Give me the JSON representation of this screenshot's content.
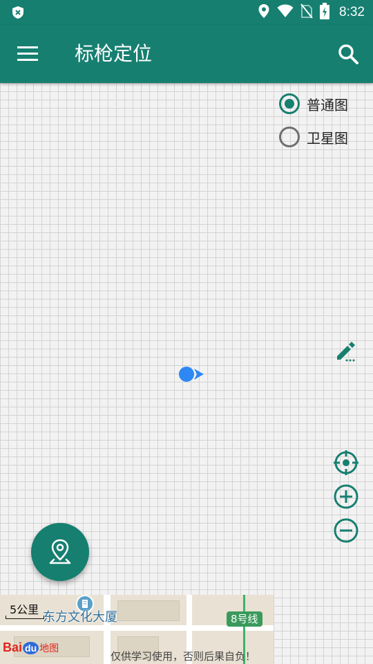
{
  "status_bar": {
    "time": "8:32",
    "icons": [
      "shield-x-icon",
      "location-icon",
      "wifi-icon",
      "no-sim-icon",
      "battery-icon"
    ]
  },
  "app_bar": {
    "title": "标枪定位",
    "menu_icon": "menu-icon",
    "search_icon": "search-icon"
  },
  "map": {
    "map_types": [
      {
        "label": "普通图",
        "selected": true
      },
      {
        "label": "卫星图",
        "selected": false
      }
    ],
    "controls": [
      "edit-icon",
      "my-location-icon",
      "zoom-in-icon",
      "zoom-out-icon"
    ],
    "scale_label": "5公里",
    "poi_name": "东方文化大厦",
    "metro_label": "8号线",
    "logo": {
      "bai": "Bai",
      "du": "du",
      "ditu": "地图"
    },
    "disclaimer": "仅供学习使用，否则后果自负！"
  },
  "fab_icon": "location-pin-icon",
  "colors": {
    "primary": "#167f70",
    "location_dot": "#2d88f3",
    "grid_line": "#d3d3d3"
  }
}
